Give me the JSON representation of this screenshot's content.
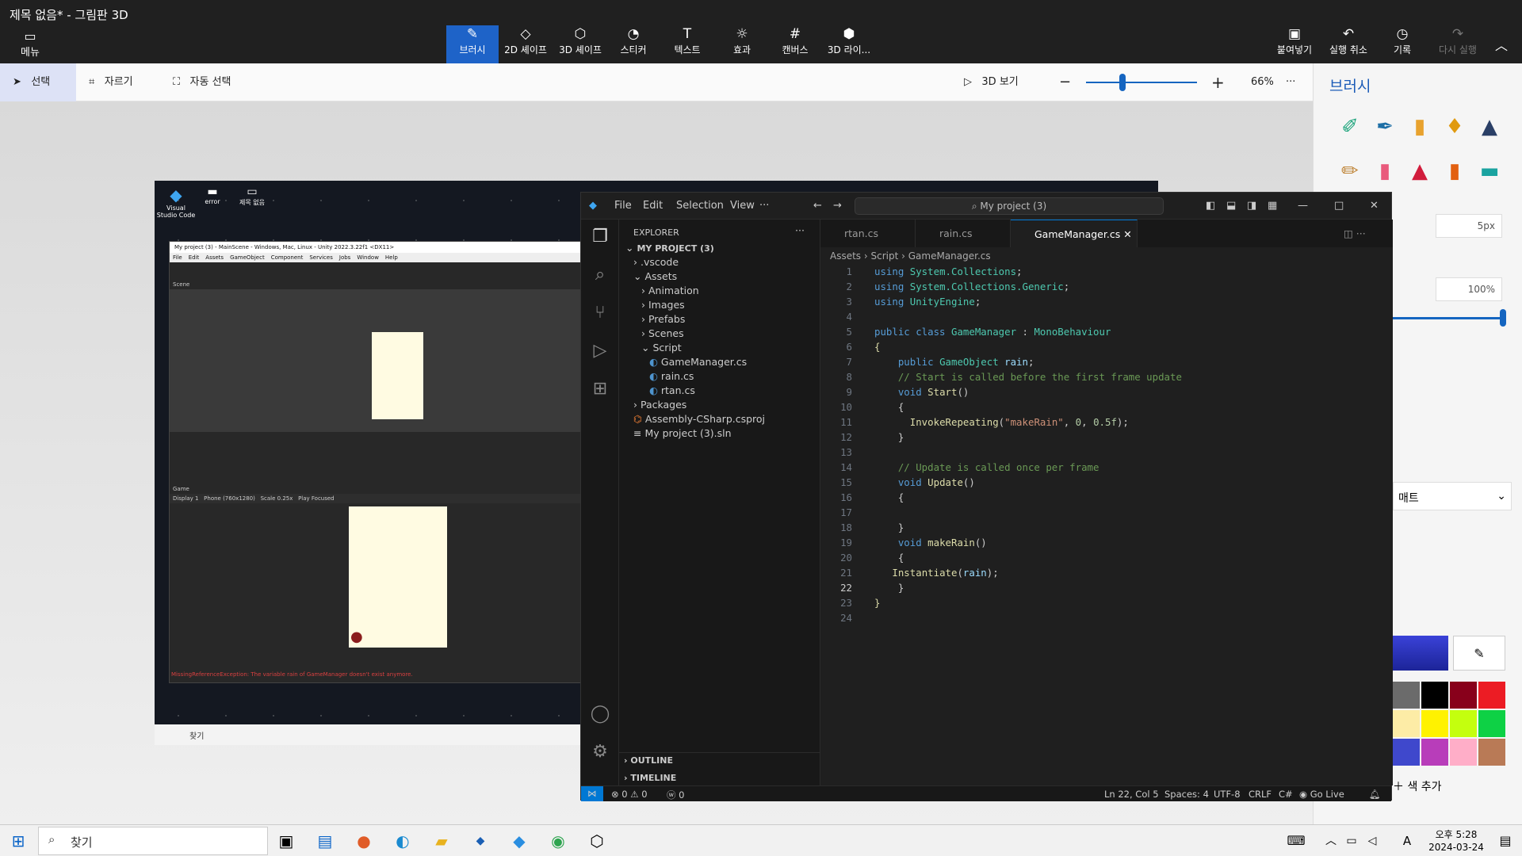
{
  "window_title": "제목 없음* - 그림판 3D",
  "menu_label": "메뉴",
  "tools": [
    "브러시",
    "2D 셰이프",
    "3D 셰이프",
    "스티커",
    "텍스트",
    "효과",
    "캔버스",
    "3D 라이..."
  ],
  "right_tools": [
    "붙여넣기",
    "실행 취소",
    "기록",
    "다시 실행"
  ],
  "toolbar": {
    "select": "선택",
    "crop": "자르기",
    "magic_select": "자동 선택",
    "view3d": "3D 보기",
    "zoom": "66%",
    "zoom_level": 0.33
  },
  "side_panel": {
    "title": "브러시",
    "thickness": "5px",
    "opacity": "100%",
    "finish": "매트",
    "add_color": "색 추가"
  },
  "palette": [
    "#6b6b6b",
    "#000000",
    "#88001b",
    "#ec1c24",
    "#fdeca6",
    "#fff200",
    "#c4ff0e",
    "#0ed145",
    "#3f48cc",
    "#b83dba",
    "#ffaec8",
    "#b97a56"
  ],
  "desktop_icons": [
    "Visual Studio Code",
    "error",
    "제목 없음"
  ],
  "unity": {
    "title": "My project (3) - MainScene - Windows, Mac, Linux - Unity 2022.3.22f1 <DX11>",
    "menu": [
      "File",
      "Edit",
      "Assets",
      "GameObject",
      "Component",
      "Services",
      "Jobs",
      "Window",
      "Help"
    ],
    "scene": "Scene",
    "game": "Game",
    "display": "Display 1",
    "resolution": "Phone (760x1280)",
    "scale": "Scale",
    "scale_val": "0.25x",
    "play_focused": "Play Focused",
    "error": "MissingReferenceException: The variable rain of GameManager doesn't exist anymore."
  },
  "inner_search": "찾기",
  "vscode": {
    "menu": [
      "File",
      "Edit",
      "Selection",
      "View",
      "···"
    ],
    "command_center": "My project (3)",
    "explorer_title": "EXPLORER",
    "tree": [
      {
        "label": "MY PROJECT (3)",
        "depth": 0,
        "icon": "v",
        "bold": true
      },
      {
        "label": ".vscode",
        "depth": 1,
        "icon": ">"
      },
      {
        "label": "Assets",
        "depth": 1,
        "icon": "v"
      },
      {
        "label": "Animation",
        "depth": 2,
        "icon": ">"
      },
      {
        "label": "Images",
        "depth": 2,
        "icon": ">"
      },
      {
        "label": "Prefabs",
        "depth": 2,
        "icon": ">"
      },
      {
        "label": "Scenes",
        "depth": 2,
        "icon": ">"
      },
      {
        "label": "Script",
        "depth": 2,
        "icon": "v"
      },
      {
        "label": "GameManager.cs",
        "depth": 3,
        "icon": "C#"
      },
      {
        "label": "rain.cs",
        "depth": 3,
        "icon": "C#"
      },
      {
        "label": "rtan.cs",
        "depth": 3,
        "icon": "C#"
      },
      {
        "label": "Packages",
        "depth": 1,
        "icon": ">"
      },
      {
        "label": "Assembly-CSharp.csproj",
        "depth": 1,
        "icon": "rss"
      },
      {
        "label": "My project (3).sln",
        "depth": 1,
        "icon": "≡"
      }
    ],
    "outline": "OUTLINE",
    "timeline": "TIMELINE",
    "tabs": [
      "rtan.cs",
      "rain.cs",
      "GameManager.cs"
    ],
    "breadcrumb": [
      "Assets",
      "Script",
      "GameManager.cs"
    ],
    "code": [
      [
        [
          "kw",
          "using "
        ],
        [
          "ty",
          "System.Collections"
        ],
        [
          "",
          "; "
        ]
      ],
      [
        [
          "kw",
          "using "
        ],
        [
          "ty",
          "System.Collections.Generic"
        ],
        [
          "",
          ";"
        ]
      ],
      [
        [
          "kw",
          "using "
        ],
        [
          "ty",
          "UnityEngine"
        ],
        [
          "",
          ";"
        ]
      ],
      [],
      [
        [
          "kw",
          "public class "
        ],
        [
          "ty",
          "GameManager"
        ],
        [
          "",
          " : "
        ],
        [
          "ty",
          "MonoBehaviour"
        ]
      ],
      [
        [
          "fn",
          "{"
        ]
      ],
      [
        [
          "",
          "    "
        ],
        [
          "kw",
          "public "
        ],
        [
          "ty",
          "GameObject "
        ],
        [
          "vr",
          "rain"
        ],
        [
          "",
          ";"
        ]
      ],
      [
        [
          "",
          "    "
        ],
        [
          "cm",
          "// Start is called before the first frame update"
        ]
      ],
      [
        [
          "",
          "    "
        ],
        [
          "kw",
          "void "
        ],
        [
          "fn",
          "Start"
        ],
        [
          "",
          "()"
        ]
      ],
      [
        [
          "",
          "    {"
        ]
      ],
      [
        [
          "",
          "      "
        ],
        [
          "fn",
          "InvokeRepeating"
        ],
        [
          "",
          "("
        ],
        [
          "st",
          "\"makeRain\""
        ],
        [
          "",
          ", "
        ],
        [
          "nm",
          "0"
        ],
        [
          "",
          ", "
        ],
        [
          "nm",
          "0.5f"
        ],
        [
          "",
          ");"
        ]
      ],
      [
        [
          "",
          "    }"
        ]
      ],
      [],
      [
        [
          "",
          "    "
        ],
        [
          "cm",
          "// Update is called once per frame"
        ]
      ],
      [
        [
          "",
          "    "
        ],
        [
          "kw",
          "void "
        ],
        [
          "fn",
          "Update"
        ],
        [
          "",
          "()"
        ]
      ],
      [
        [
          "",
          "    {"
        ]
      ],
      [],
      [
        [
          "",
          "    }"
        ]
      ],
      [
        [
          "",
          "    "
        ],
        [
          "kw",
          "void "
        ],
        [
          "fn",
          "makeRain"
        ],
        [
          "",
          "()"
        ]
      ],
      [
        [
          "",
          "    {"
        ]
      ],
      [
        [
          "",
          "   "
        ],
        [
          "fn",
          "Instantiate"
        ],
        [
          "",
          "("
        ],
        [
          "vr",
          "rain"
        ],
        [
          "",
          ");"
        ]
      ],
      [
        [
          "",
          "    }"
        ]
      ],
      [
        [
          "fn",
          "}"
        ]
      ],
      []
    ],
    "status": {
      "errors": "0",
      "warnings": "0",
      "ports": "0",
      "position": "Ln 22, Col 5",
      "spaces": "Spaces: 4",
      "encoding": "UTF-8",
      "eol": "CRLF",
      "lang": "C#",
      "golive": "Go Live"
    }
  },
  "taskbar": {
    "search": "찾기",
    "time": "오후 5:28",
    "date": "2024-03-24",
    "lang": "A"
  }
}
